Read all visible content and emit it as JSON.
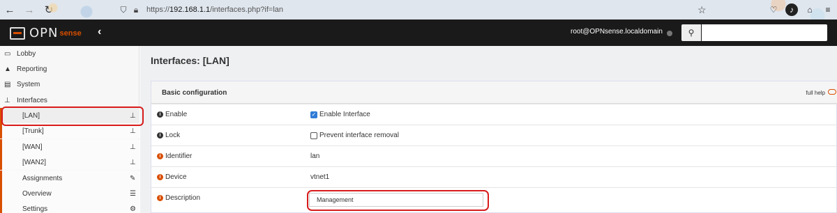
{
  "browser": {
    "url_prefix": "https://",
    "url_host": "192.168.1.1",
    "url_path": "/interfaces.php?if=lan"
  },
  "header": {
    "logo_text": "OPN",
    "logo_sub": "sense",
    "collapse_icon": "‹",
    "user": "root@OPNsense.localdomain",
    "search_placeholder": ""
  },
  "sidebar": {
    "lobby": "Lobby",
    "reporting": "Reporting",
    "system": "System",
    "interfaces": "Interfaces",
    "sub_items": [
      {
        "label": "[LAN]"
      },
      {
        "label": "[Trunk]"
      },
      {
        "label": "[WAN]"
      },
      {
        "label": "[WAN2]"
      },
      {
        "label": "Assignments"
      },
      {
        "label": "Overview"
      },
      {
        "label": "Settings"
      }
    ]
  },
  "main": {
    "title": "Interfaces: [LAN]",
    "panel_title": "Basic configuration",
    "full_help": "full help",
    "rows": {
      "enable_label": "Enable",
      "enable_value": "Enable Interface",
      "lock_label": "Lock",
      "lock_value": "Prevent interface removal",
      "identifier_label": "Identifier",
      "identifier_value": "lan",
      "device_label": "Device",
      "device_value": "vtnet1",
      "description_label": "Description",
      "description_value": "Management"
    }
  },
  "colors": {
    "accent": "#d94f00",
    "header_bg": "#1a1a1a",
    "highlight": "#d81b1b",
    "checkbox": "#2f7bd6"
  }
}
